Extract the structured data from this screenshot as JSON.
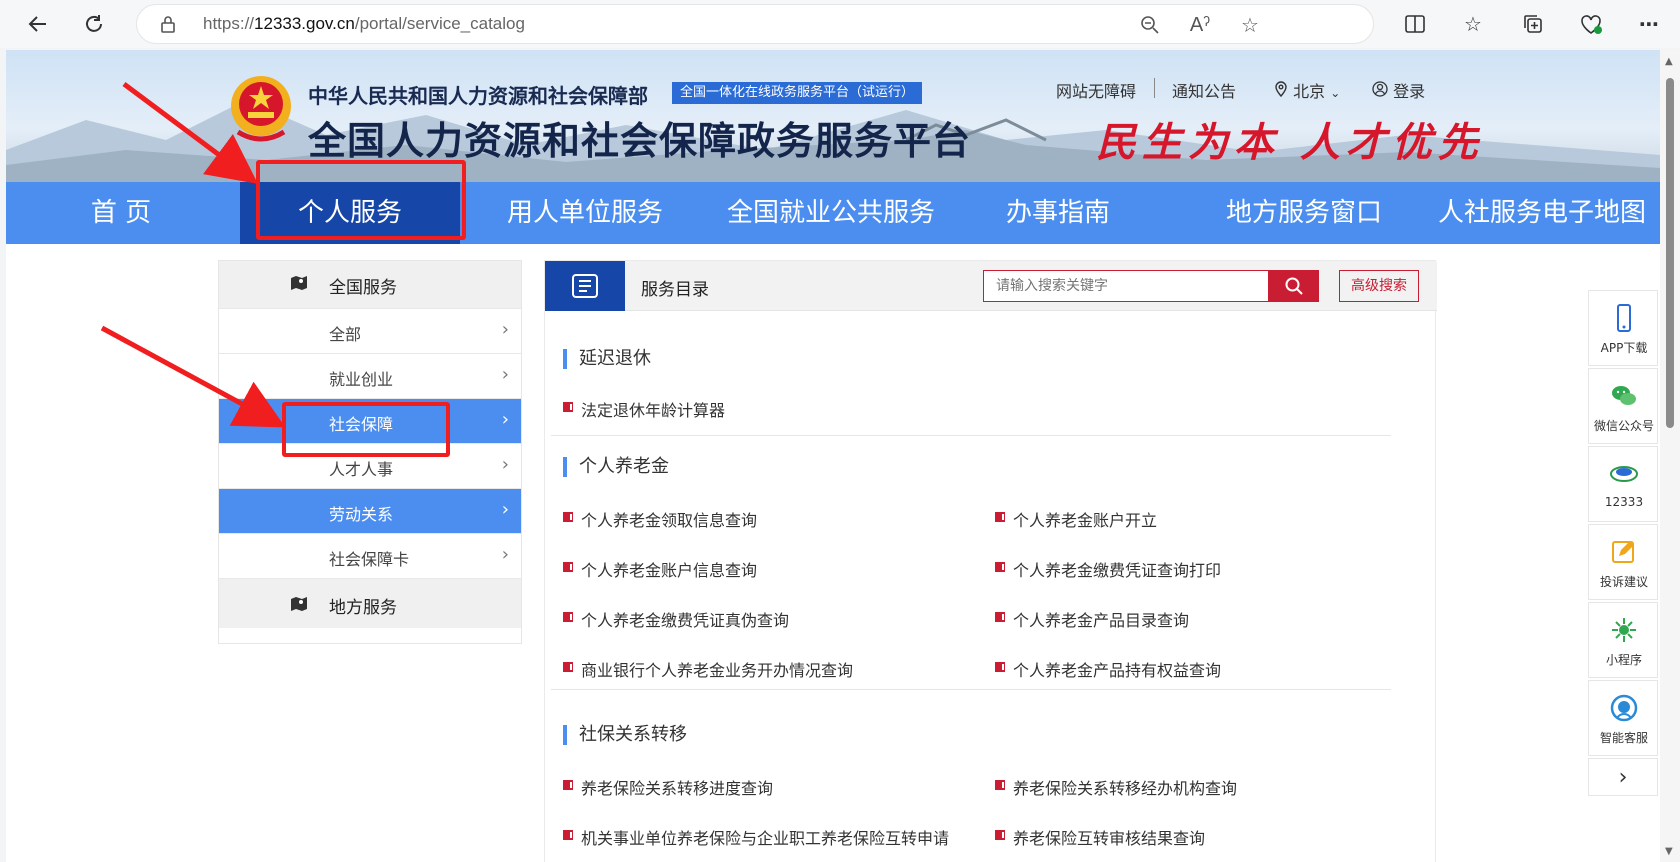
{
  "browser": {
    "url_prefix": "https://",
    "url_host": "12333.gov.cn",
    "url_path": "/portal/service_catalog"
  },
  "header": {
    "ministry": "中华人民共和国人力资源和社会保障部",
    "tag": "全国一体化在线政务服务平台（试运行）",
    "platform_title": "全国人力资源和社会保障政务服务平台",
    "slogan": "民生为本 人才优先",
    "links": {
      "accessibility": "网站无障碍",
      "notice": "通知公告",
      "location": "北京",
      "login": "登录"
    }
  },
  "main_nav": [
    {
      "label": "首  页",
      "active": false
    },
    {
      "label": "个人服务",
      "active": true
    },
    {
      "label": "用人单位服务",
      "active": false
    },
    {
      "label": "全国就业公共服务",
      "active": false
    },
    {
      "label": "办事指南",
      "active": false
    },
    {
      "label": "地方服务窗口",
      "active": false
    },
    {
      "label": "人社服务电子地图",
      "active": false
    }
  ],
  "left_panel": {
    "national": "全国服务",
    "items": [
      {
        "label": "全部",
        "active": false
      },
      {
        "label": "就业创业",
        "active": false
      },
      {
        "label": "社会保障",
        "active": true
      },
      {
        "label": "人才人事",
        "active": false
      },
      {
        "label": "劳动关系",
        "active": true
      },
      {
        "label": "社会保障卡",
        "active": false
      }
    ],
    "local": "地方服务"
  },
  "catalog": {
    "title": "服务目录",
    "search_placeholder": "请输入搜索关键字",
    "advanced": "高级搜索",
    "sections": [
      {
        "title": "延迟退休",
        "items": [
          "法定退休年龄计算器"
        ]
      },
      {
        "title": "个人养老金",
        "items": [
          "个人养老金领取信息查询",
          "个人养老金账户开立",
          "个人养老金账户信息查询",
          "个人养老金缴费凭证查询打印",
          "个人养老金缴费凭证真伪查询",
          "个人养老金产品目录查询",
          "商业银行个人养老金业务开办情况查询",
          "个人养老金产品持有权益查询"
        ]
      },
      {
        "title": "社保关系转移",
        "items": [
          "养老保险关系转移进度查询",
          "养老保险关系转移经办机构查询",
          "机关事业单位养老保险与企业职工养老保险互转申请",
          "养老保险互转审核结果查询"
        ]
      }
    ]
  },
  "sidebar": [
    {
      "label": "APP下载",
      "icon": "phone-icon"
    },
    {
      "label": "微信公众号",
      "icon": "wechat-icon"
    },
    {
      "label": "12333",
      "icon": "12333-logo-icon"
    },
    {
      "label": "投诉建议",
      "icon": "edit-icon"
    },
    {
      "label": "小程序",
      "icon": "miniprogram-icon"
    },
    {
      "label": "智能客服",
      "icon": "headset-icon"
    }
  ],
  "colors": {
    "nav_blue": "#4b8ef0",
    "nav_active": "#1546a8",
    "accent_red": "#c81d33",
    "annotation_red": "#f01e1e"
  }
}
